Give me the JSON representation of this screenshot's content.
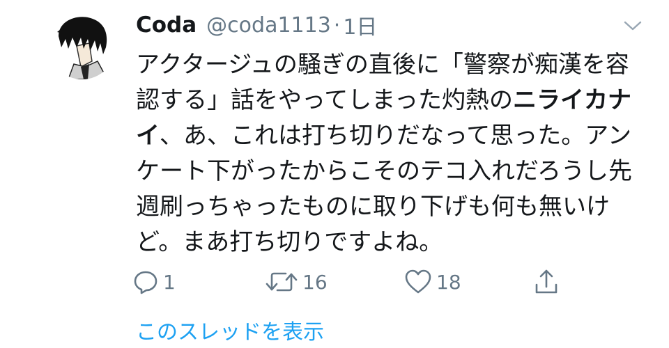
{
  "tweet": {
    "display_name": "Coda",
    "handle": "@coda1113",
    "separator": "·",
    "timestamp": "1日",
    "text_part1": "アクタージュの騒ぎの直後に「警察が痴漢を容認する」話をやってしまった灼熱の",
    "text_bold": "ニライカナイ",
    "text_part2": "、あ、これは打ち切りだなって思った。アンケート下がったからこそのテコ入れだろうし先週刷っちゃったものに取り下げも何も無いけど。まあ打ち切りですよね。"
  },
  "actions": {
    "reply_count": "1",
    "retweet_count": "16",
    "like_count": "18"
  },
  "thread_link": "このスレッドを表示",
  "icons": [
    "chevron-down-icon",
    "reply-icon",
    "retweet-icon",
    "like-icon",
    "share-icon"
  ],
  "colors": {
    "text": "#14171a",
    "muted": "#657786",
    "link": "#1da1f2"
  }
}
